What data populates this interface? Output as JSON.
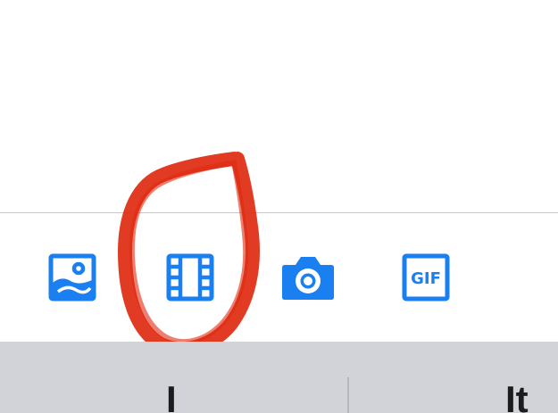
{
  "toolbar": {
    "accent_color": "#1a7ff0",
    "buttons": [
      {
        "icon": "photo-library-icon"
      },
      {
        "icon": "video-film-icon"
      },
      {
        "icon": "camera-icon"
      },
      {
        "icon": "gif-icon",
        "label": "GIF"
      }
    ]
  },
  "annotation": {
    "color": "#e02a10",
    "circled_item": "video-film-icon"
  },
  "keyboard": {
    "suggestions": [
      "I",
      "It"
    ]
  }
}
